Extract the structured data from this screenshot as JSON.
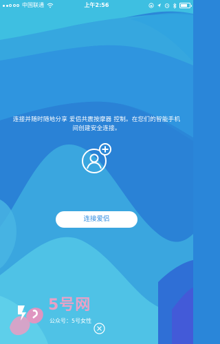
{
  "status_bar": {
    "carrier": "中国联通",
    "time": "上午2:56"
  },
  "main": {
    "description": "连接并随时随地分享 爱侣共震按摩器 控制。在您们的智能手机间创建安全连接。",
    "connect_button_label": "连接爱侣"
  },
  "watermark": {
    "site": "5号网",
    "account": "公众号：5号女性"
  },
  "colors": {
    "background_primary": "#2a86d9",
    "background_light": "#45c4e3",
    "button_text": "#2f8be0",
    "watermark_pink": "#e9a1c6"
  },
  "icons": [
    "signal-icon",
    "wifi-icon",
    "lock-icon",
    "location-icon",
    "alarm-icon",
    "bluetooth-icon",
    "battery-icon",
    "add-user-icon",
    "close-icon"
  ]
}
